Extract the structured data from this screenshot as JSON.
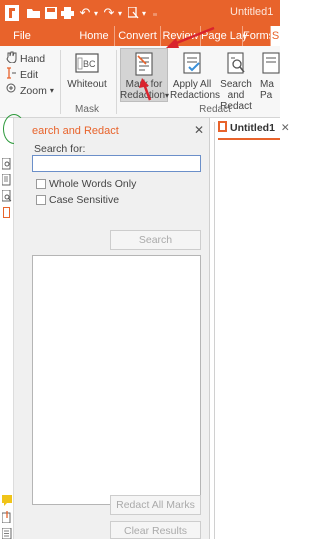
{
  "window": {
    "title": "Untitled1"
  },
  "tabs": [
    {
      "label": "File",
      "active": false
    },
    {
      "label": "Home",
      "active": false
    },
    {
      "label": "Convert",
      "active": false
    },
    {
      "label": "Review",
      "active": false
    },
    {
      "label": "Page Lay",
      "active": false
    },
    {
      "label": "Forms",
      "active": false
    },
    {
      "label": "S",
      "active": true
    }
  ],
  "ribbon": {
    "tools": {
      "hand": "Hand",
      "edit": "Edit",
      "zoom": "Zoom"
    },
    "whiteout": "Whiteout",
    "mark_for": "Mark for",
    "redaction": "Redaction",
    "apply_all": "Apply All",
    "redactions": "Redactions",
    "search_and": "Search and",
    "redact": "Redact",
    "ma": "Ma",
    "pa": "Pa",
    "group_mask": "Mask",
    "group_redact": "Redact"
  },
  "panel": {
    "title": "earch and Redact",
    "search_for_label": "Search for:",
    "search_value": "",
    "whole_words": "Whole Words Only",
    "case_sensitive": "Case Sensitive",
    "search_button": "Search",
    "redact_all_button": "Redact All Marks",
    "clear_button": "Clear Results"
  },
  "document": {
    "tab_label": "Untitled1"
  },
  "colors": {
    "accent": "#e8632b",
    "annotation_circle": "#2d9a3c",
    "annotation_arrow": "#d9232d"
  }
}
